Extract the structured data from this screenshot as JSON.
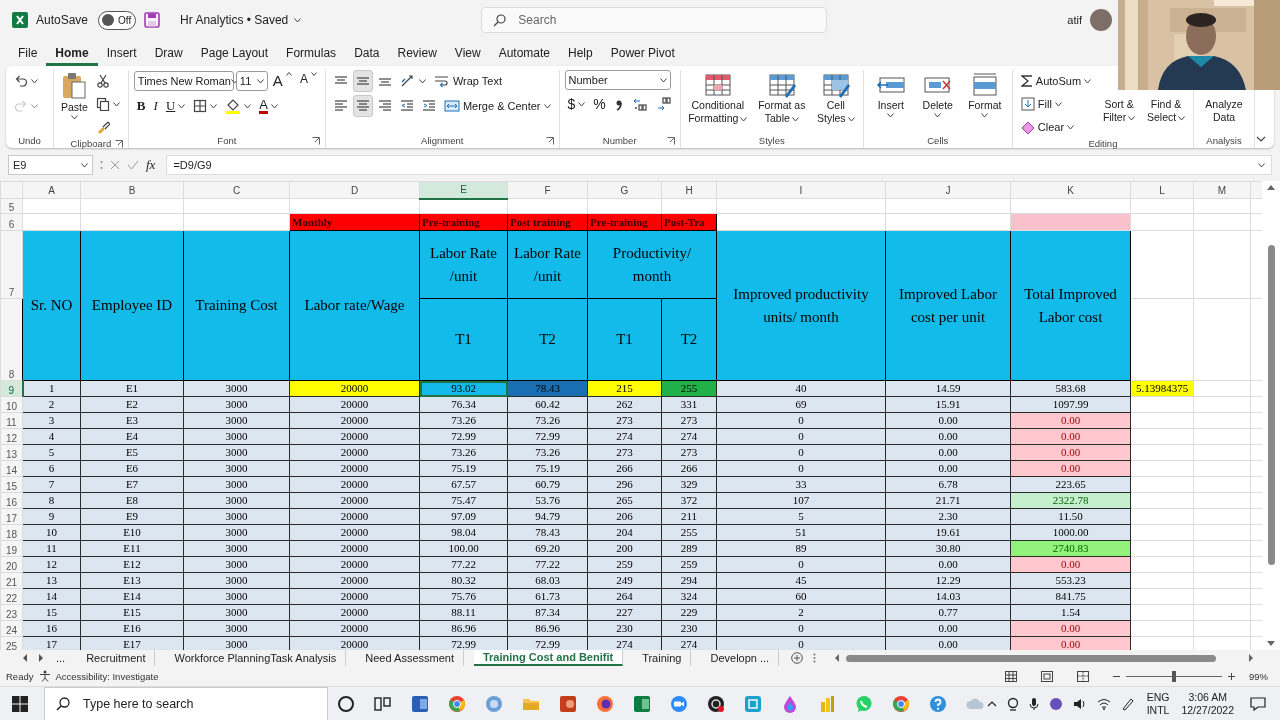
{
  "title_bar": {
    "autosave": {
      "label": "AutoSave",
      "on": false,
      "state_text": "Off"
    },
    "document": "Hr Analytics • Saved",
    "search_placeholder": "Search",
    "user": "atif"
  },
  "menu_tabs": [
    {
      "label": "File",
      "selected": false
    },
    {
      "label": "Home",
      "selected": true
    },
    {
      "label": "Insert",
      "selected": false
    },
    {
      "label": "Draw",
      "selected": false
    },
    {
      "label": "Page Layout",
      "selected": false
    },
    {
      "label": "Formulas",
      "selected": false
    },
    {
      "label": "Data",
      "selected": false
    },
    {
      "label": "Review",
      "selected": false
    },
    {
      "label": "View",
      "selected": false
    },
    {
      "label": "Automate",
      "selected": false
    },
    {
      "label": "Help",
      "selected": false
    },
    {
      "label": "Power Pivot",
      "selected": false
    }
  ],
  "ribbon": {
    "groups": {
      "undo": "Undo",
      "clipboard": "Clipboard",
      "font": "Font",
      "alignment": "Alignment",
      "number": "Number",
      "styles": "Styles",
      "cells": "Cells",
      "editing": "Editing",
      "analysis": "Analysis"
    },
    "paste": "Paste",
    "font_name": "Times New Roman",
    "font_size": "11",
    "grow_font": "A",
    "shrink_font": "A",
    "bold": "B",
    "italic": "I",
    "underline": "U",
    "font_color": "A",
    "vertical_align": [
      {
        "selected": false
      },
      {
        "selected": true
      },
      {
        "selected": false
      }
    ],
    "horizontal_align": [
      {
        "selected": false
      },
      {
        "selected": true
      },
      {
        "selected": false
      }
    ],
    "wrap_text": "Wrap Text",
    "merge_center": "Merge & Center",
    "number_format": "Number",
    "currency": "$",
    "percent": "%",
    "styles": [
      "Conditional Formatting",
      "Format as Table",
      "Cell Styles"
    ],
    "cells": [
      "Insert",
      "Delete",
      "Format"
    ],
    "autosum": "AutoSum",
    "fill": "Fill",
    "clear": "Clear",
    "sort_filter": "Sort & Filter",
    "find_select": "Find & Select",
    "analyze_data": "Analyze Data"
  },
  "formula_bar": {
    "name_box": "E9",
    "fx": "fx",
    "formula": "=D9/G9"
  },
  "sheet": {
    "columns": [
      {
        "label": "A",
        "selected": false
      },
      {
        "label": "B",
        "selected": false
      },
      {
        "label": "C",
        "selected": false
      },
      {
        "label": "D",
        "selected": false
      },
      {
        "label": "E",
        "selected": true
      },
      {
        "label": "F",
        "selected": false
      },
      {
        "label": "G",
        "selected": false
      },
      {
        "label": "H",
        "selected": false
      },
      {
        "label": "I",
        "selected": false
      },
      {
        "label": "J",
        "selected": false
      },
      {
        "label": "K",
        "selected": false
      },
      {
        "label": "L",
        "selected": false
      },
      {
        "label": "M",
        "selected": false
      }
    ],
    "top_rows": [
      "5",
      "6",
      "7",
      "8"
    ],
    "band": [
      "Monthly",
      "Pre-training",
      "Post training",
      "Pre-training",
      "Post-Tra"
    ],
    "headers": [
      {
        "kind": "single",
        "text": "Sr. NO"
      },
      {
        "kind": "single",
        "text": "Employee ID"
      },
      {
        "kind": "single",
        "text": "Training Cost"
      },
      {
        "kind": "single",
        "text": "Labor rate/Wage"
      },
      {
        "kind": "split",
        "text": "Labor Rate /unit",
        "subs": [
          "T1"
        ]
      },
      {
        "kind": "split",
        "text": "Labor Rate /unit",
        "subs": [
          "T2"
        ]
      },
      {
        "kind": "pair",
        "text": "Productivity/ month",
        "subs": [
          "T1",
          "T2"
        ]
      },
      {
        "kind": "single",
        "text": "Improved productivity units/ month"
      },
      {
        "kind": "single",
        "text": "Improved Labor cost per unit"
      },
      {
        "kind": "single",
        "text": "Total Improved Labor cost"
      }
    ],
    "rows": [
      {
        "number": "9",
        "selected": true,
        "cells": [
          {
            "text": "1"
          },
          {
            "text": "E1"
          },
          {
            "text": "3000"
          },
          {
            "text": "20000",
            "color": "#ffff00"
          },
          {
            "text": "93.02",
            "color": "#13b9e9"
          },
          {
            "text": "78.43",
            "color": "#1a6fb3"
          },
          {
            "text": "215",
            "color": "#ffff00"
          },
          {
            "text": "255",
            "color": "#22b04a"
          },
          {
            "text": "40"
          },
          {
            "text": "14.59"
          },
          {
            "text": "583.68"
          },
          {
            "text": "5.13984375",
            "color": "#ffff00"
          }
        ]
      },
      {
        "number": "10",
        "selected": false,
        "cells": [
          {
            "text": "2"
          },
          {
            "text": "E2"
          },
          {
            "text": "3000"
          },
          {
            "text": "20000"
          },
          {
            "text": "76.34"
          },
          {
            "text": "60.42"
          },
          {
            "text": "262"
          },
          {
            "text": "331"
          },
          {
            "text": "69"
          },
          {
            "text": "15.91"
          },
          {
            "text": "1097.99"
          }
        ]
      },
      {
        "number": "11",
        "selected": false,
        "cells": [
          {
            "text": "3"
          },
          {
            "text": "E3"
          },
          {
            "text": "3000"
          },
          {
            "text": "20000"
          },
          {
            "text": "73.26"
          },
          {
            "text": "73.26"
          },
          {
            "text": "273"
          },
          {
            "text": "273"
          },
          {
            "text": "0"
          },
          {
            "text": "0.00"
          },
          {
            "text": "0.00",
            "kind": "bad",
            "color": "#ffc7ce"
          }
        ]
      },
      {
        "number": "12",
        "selected": false,
        "cells": [
          {
            "text": "4"
          },
          {
            "text": "E4"
          },
          {
            "text": "3000"
          },
          {
            "text": "20000"
          },
          {
            "text": "72.99"
          },
          {
            "text": "72.99"
          },
          {
            "text": "274"
          },
          {
            "text": "274"
          },
          {
            "text": "0"
          },
          {
            "text": "0.00"
          },
          {
            "text": "0.00",
            "kind": "bad",
            "color": "#ffc7ce"
          }
        ]
      },
      {
        "number": "13",
        "selected": false,
        "cells": [
          {
            "text": "5"
          },
          {
            "text": "E5"
          },
          {
            "text": "3000"
          },
          {
            "text": "20000"
          },
          {
            "text": "73.26"
          },
          {
            "text": "73.26"
          },
          {
            "text": "273"
          },
          {
            "text": "273"
          },
          {
            "text": "0"
          },
          {
            "text": "0.00"
          },
          {
            "text": "0.00",
            "kind": "bad",
            "color": "#ffc7ce"
          }
        ]
      },
      {
        "number": "14",
        "selected": false,
        "cells": [
          {
            "text": "6"
          },
          {
            "text": "E6"
          },
          {
            "text": "3000"
          },
          {
            "text": "20000"
          },
          {
            "text": "75.19"
          },
          {
            "text": "75.19"
          },
          {
            "text": "266"
          },
          {
            "text": "266"
          },
          {
            "text": "0"
          },
          {
            "text": "0.00"
          },
          {
            "text": "0.00",
            "kind": "bad",
            "color": "#ffc7ce"
          }
        ]
      },
      {
        "number": "15",
        "selected": false,
        "cells": [
          {
            "text": "7"
          },
          {
            "text": "E7"
          },
          {
            "text": "3000"
          },
          {
            "text": "20000"
          },
          {
            "text": "67.57"
          },
          {
            "text": "60.79"
          },
          {
            "text": "296"
          },
          {
            "text": "329"
          },
          {
            "text": "33"
          },
          {
            "text": "6.78"
          },
          {
            "text": "223.65"
          }
        ]
      },
      {
        "number": "16",
        "selected": false,
        "cells": [
          {
            "text": "8"
          },
          {
            "text": "E8"
          },
          {
            "text": "3000"
          },
          {
            "text": "20000"
          },
          {
            "text": "75.47"
          },
          {
            "text": "53.76"
          },
          {
            "text": "265"
          },
          {
            "text": "372"
          },
          {
            "text": "107"
          },
          {
            "text": "21.71"
          },
          {
            "text": "2322.78",
            "kind": "good",
            "color": "#c6efce"
          }
        ]
      },
      {
        "number": "17",
        "selected": false,
        "cells": [
          {
            "text": "9"
          },
          {
            "text": "E9"
          },
          {
            "text": "3000"
          },
          {
            "text": "20000"
          },
          {
            "text": "97.09"
          },
          {
            "text": "94.79"
          },
          {
            "text": "206"
          },
          {
            "text": "211"
          },
          {
            "text": "5"
          },
          {
            "text": "2.30"
          },
          {
            "text": "11.50"
          }
        ]
      },
      {
        "number": "18",
        "selected": false,
        "cells": [
          {
            "text": "10"
          },
          {
            "text": "E10"
          },
          {
            "text": "3000"
          },
          {
            "text": "20000"
          },
          {
            "text": "98.04"
          },
          {
            "text": "78.43"
          },
          {
            "text": "204"
          },
          {
            "text": "255"
          },
          {
            "text": "51"
          },
          {
            "text": "19.61"
          },
          {
            "text": "1000.00"
          }
        ]
      },
      {
        "number": "19",
        "selected": false,
        "cells": [
          {
            "text": "11"
          },
          {
            "text": "E11"
          },
          {
            "text": "3000"
          },
          {
            "text": "20000"
          },
          {
            "text": "100.00"
          },
          {
            "text": "69.20"
          },
          {
            "text": "200"
          },
          {
            "text": "289"
          },
          {
            "text": "89"
          },
          {
            "text": "30.80"
          },
          {
            "text": "2740.83",
            "kind": "good",
            "color": "#92f27c"
          }
        ]
      },
      {
        "number": "20",
        "selected": false,
        "cells": [
          {
            "text": "12"
          },
          {
            "text": "E12"
          },
          {
            "text": "3000"
          },
          {
            "text": "20000"
          },
          {
            "text": "77.22"
          },
          {
            "text": "77.22"
          },
          {
            "text": "259"
          },
          {
            "text": "259"
          },
          {
            "text": "0"
          },
          {
            "text": "0.00"
          },
          {
            "text": "0.00",
            "kind": "bad",
            "color": "#ffc7ce"
          }
        ]
      },
      {
        "number": "21",
        "selected": false,
        "cells": [
          {
            "text": "13"
          },
          {
            "text": "E13"
          },
          {
            "text": "3000"
          },
          {
            "text": "20000"
          },
          {
            "text": "80.32"
          },
          {
            "text": "68.03"
          },
          {
            "text": "249"
          },
          {
            "text": "294"
          },
          {
            "text": "45"
          },
          {
            "text": "12.29"
          },
          {
            "text": "553.23"
          }
        ]
      },
      {
        "number": "22",
        "selected": false,
        "cells": [
          {
            "text": "14"
          },
          {
            "text": "E14"
          },
          {
            "text": "3000"
          },
          {
            "text": "20000"
          },
          {
            "text": "75.76"
          },
          {
            "text": "61.73"
          },
          {
            "text": "264"
          },
          {
            "text": "324"
          },
          {
            "text": "60"
          },
          {
            "text": "14.03"
          },
          {
            "text": "841.75"
          }
        ]
      },
      {
        "number": "23",
        "selected": false,
        "cells": [
          {
            "text": "15"
          },
          {
            "text": "E15"
          },
          {
            "text": "3000"
          },
          {
            "text": "20000"
          },
          {
            "text": "88.11"
          },
          {
            "text": "87.34"
          },
          {
            "text": "227"
          },
          {
            "text": "229"
          },
          {
            "text": "2"
          },
          {
            "text": "0.77"
          },
          {
            "text": "1.54"
          }
        ]
      },
      {
        "number": "24",
        "selected": false,
        "cells": [
          {
            "text": "16"
          },
          {
            "text": "E16"
          },
          {
            "text": "3000"
          },
          {
            "text": "20000"
          },
          {
            "text": "86.96"
          },
          {
            "text": "86.96"
          },
          {
            "text": "230"
          },
          {
            "text": "230"
          },
          {
            "text": "0"
          },
          {
            "text": "0.00"
          },
          {
            "text": "0.00",
            "kind": "bad",
            "color": "#ffc7ce"
          }
        ]
      },
      {
        "number": "25",
        "selected": false,
        "cells": [
          {
            "text": "17"
          },
          {
            "text": "E17"
          },
          {
            "text": "3000"
          },
          {
            "text": "20000"
          },
          {
            "text": "72.99"
          },
          {
            "text": "72.99"
          },
          {
            "text": "274"
          },
          {
            "text": "274"
          },
          {
            "text": "0"
          },
          {
            "text": "0.00"
          },
          {
            "text": "0.00",
            "kind": "bad",
            "color": "#ffc7ce"
          }
        ]
      }
    ]
  },
  "sheet_tabs": {
    "more": "...",
    "tabs": [
      {
        "label": "Recruitment",
        "selected": false
      },
      {
        "label": "Workforce PlanningTask Analysis",
        "selected": false
      },
      {
        "label": "Need Assessment",
        "selected": false
      },
      {
        "label": "Training Cost and Benifit",
        "selected": true
      },
      {
        "label": "Training",
        "selected": false
      },
      {
        "label": "Developn ...",
        "selected": false
      }
    ]
  },
  "status_bar": {
    "mode": "Ready",
    "accessibility": "Accessibility: Investigate",
    "zoom": {
      "level": 0.5,
      "label": "99%"
    }
  },
  "taskbar": {
    "search_placeholder": "Type here to search",
    "language": "ENG",
    "layout": "INTL",
    "time": "3:06 AM",
    "date": "12/27/2022"
  }
}
